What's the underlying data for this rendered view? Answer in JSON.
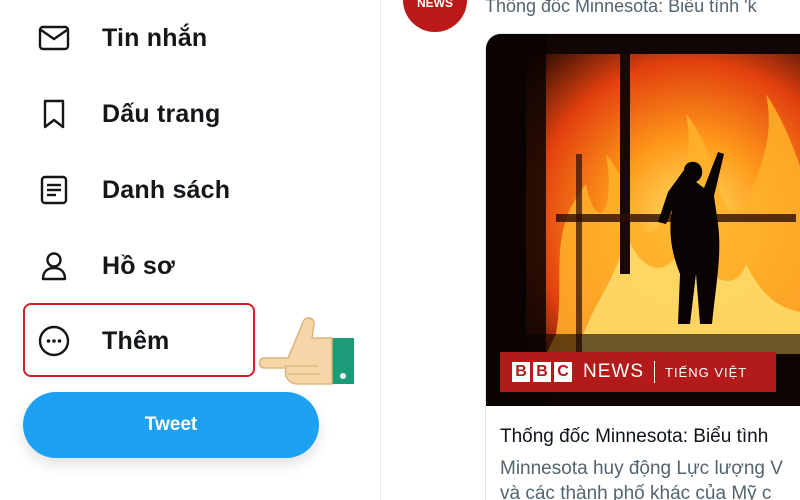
{
  "sidebar": {
    "items": [
      {
        "label": "Tin nhắn",
        "icon": "mail-icon"
      },
      {
        "label": "Dấu trang",
        "icon": "bookmark-icon"
      },
      {
        "label": "Danh sách",
        "icon": "list-icon"
      },
      {
        "label": "Hồ sơ",
        "icon": "profile-icon"
      },
      {
        "label": "Thêm",
        "icon": "more-circle-icon"
      }
    ],
    "tweet_button": "Tweet"
  },
  "feed": {
    "avatar_label": "NEWS",
    "header_text": "Thống đốc Minnesota: Biểu tình 'k",
    "card": {
      "brand_letters": [
        "B",
        "B",
        "C"
      ],
      "brand_news": "NEWS",
      "brand_sub": "TIẾNG VIỆT",
      "title": "Thống đốc Minnesota: Biểu tình",
      "desc_line1": "Minnesota huy động Lực lượng V",
      "desc_line2": "và các thành phố khác của Mỹ c"
    }
  },
  "colors": {
    "accent": "#1da1f2",
    "highlight": "#d0202c",
    "bbc_red": "#b31b1b"
  }
}
